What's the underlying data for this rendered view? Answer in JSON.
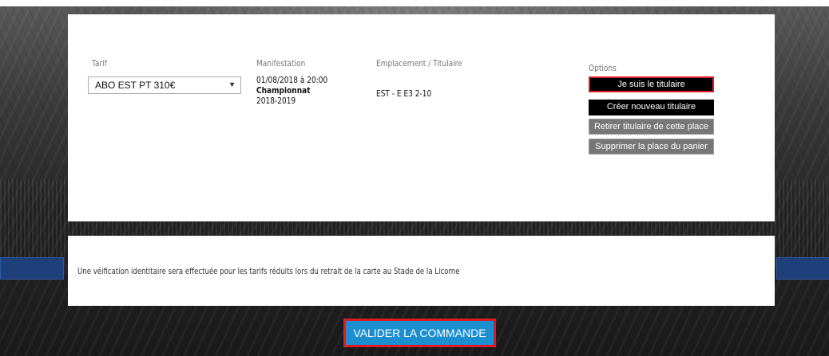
{
  "order": {
    "columns": {
      "tarif": "Tarif",
      "manifestation": "Manifestation",
      "emplacement": "Emplacement / Titulaire",
      "options": "Options"
    },
    "tarif_selected": "ABO EST PT 310€",
    "manifestation": {
      "date": "01/08/2018 à 20:00",
      "name": "Championnat",
      "season": "2018-2019"
    },
    "emplacement": "EST - E E3 2-10",
    "options": {
      "titulaire": "Je suis le titulaire",
      "nouveau": "Créer nouveau titulaire",
      "retirer": "Retirer titulaire de cette place",
      "supprimer": "Supprimer la place du panier"
    }
  },
  "notice": "Une véification identitaire sera effectuée pour les tarifs réduits lors du retrait de la carte au Stade de la Licorne",
  "validate_label": "VALIDER LA COMMANDE",
  "colors": {
    "primary_button": "#1b8fd0",
    "highlight_outline": "#e01b24",
    "option_dark": "#000000",
    "option_grey": "#777777"
  }
}
